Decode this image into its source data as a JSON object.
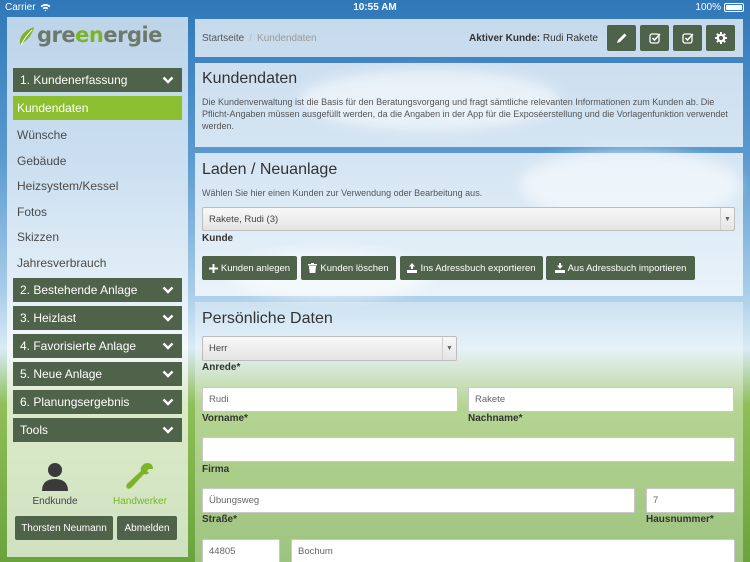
{
  "status_bar": {
    "carrier": "Carrier",
    "time": "10:55 AM",
    "battery": "100%"
  },
  "logo": {
    "part1": "gre",
    "part2": "en",
    "part3": "ergie"
  },
  "sidebar": {
    "items": [
      {
        "label": "1. Kundenerfassung",
        "type": "header"
      },
      {
        "label": "Kundendaten",
        "type": "active"
      },
      {
        "label": "Wünsche",
        "type": "sub"
      },
      {
        "label": "Gebäude",
        "type": "sub"
      },
      {
        "label": "Heizsystem/Kessel",
        "type": "sub"
      },
      {
        "label": "Fotos",
        "type": "sub"
      },
      {
        "label": "Skizzen",
        "type": "sub"
      },
      {
        "label": "Jahresverbrauch",
        "type": "sub"
      },
      {
        "label": "2. Bestehende Anlage",
        "type": "header"
      },
      {
        "label": "3. Heizlast",
        "type": "header"
      },
      {
        "label": "4. Favorisierte Anlage",
        "type": "header"
      },
      {
        "label": "5. Neue Anlage",
        "type": "header"
      },
      {
        "label": "6. Planungsergebnis",
        "type": "header"
      },
      {
        "label": "Tools",
        "type": "header"
      }
    ],
    "roles": {
      "endkunde": "Endkunde",
      "handwerker": "Handwerker"
    },
    "user_button": "Thorsten Neumann",
    "logout_button": "Abmelden"
  },
  "topbar": {
    "breadcrumb": [
      "Startseite",
      "Kundendaten"
    ],
    "active_customer_label": "Aktiver Kunde:",
    "active_customer_name": "Rudi Rakete",
    "tools": [
      "pencil-icon",
      "check-square-icon",
      "check-square-icon",
      "gear-icon"
    ]
  },
  "kundendaten": {
    "title": "Kundendaten",
    "description": "Die Kundenverwaltung ist die Basis für den Beratungsvorgang und fragt sämtliche relevanten Informationen zum Kunden ab. Die Pflicht-Angaben müssen ausgefüllt werden, da die Angaben in der App für die Exposéerstellung und die Vorlagenfunktion verwendet werden."
  },
  "laden": {
    "title": "Laden / Neuanlage",
    "description": "Wählen Sie hier einen Kunden zur Verwendung oder Bearbeitung aus.",
    "customer_select": "Rakete, Rudi (3)",
    "customer_label": "Kunde",
    "buttons": {
      "create": "Kunden anlegen",
      "delete": "Kunden löschen",
      "export": "Ins Adressbuch exportieren",
      "import": "Aus Adressbuch importieren"
    }
  },
  "persoenlich": {
    "title": "Persönliche Daten",
    "anrede": {
      "value": "Herr",
      "label": "Anrede*"
    },
    "vorname": {
      "value": "Rudi",
      "label": "Vorname*"
    },
    "nachname": {
      "value": "Rakete",
      "label": "Nachname*"
    },
    "firma": {
      "value": "",
      "label": "Firma"
    },
    "strasse": {
      "value": "Übungsweg",
      "label": "Straße*"
    },
    "hausnummer": {
      "value": "7",
      "label": "Hausnummer*"
    },
    "plz": {
      "value": "44805"
    },
    "ort": {
      "value": "Bochum"
    }
  }
}
